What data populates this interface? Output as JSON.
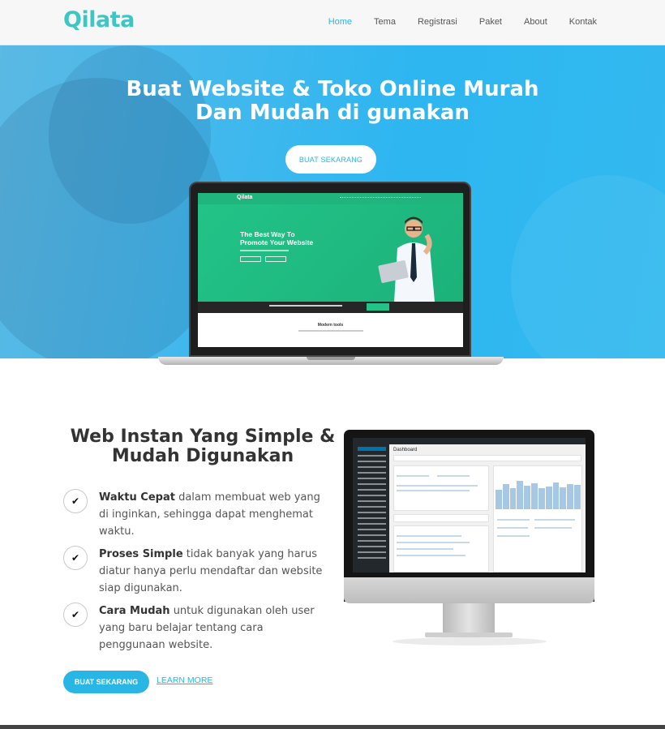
{
  "brand": {
    "logo": "Qilata",
    "accent": "#3ec6c3",
    "primary": "#29b6e4"
  },
  "nav": {
    "items": [
      {
        "label": "Home",
        "active": true
      },
      {
        "label": "Tema"
      },
      {
        "label": "Registrasi"
      },
      {
        "label": "Paket"
      },
      {
        "label": "About"
      },
      {
        "label": "Kontak"
      }
    ]
  },
  "hero": {
    "title_line1": "Buat Website & Toko Online Murah",
    "title_line2": "Dan Mudah di gunakan",
    "cta_label": "BUAT SEKARANG",
    "laptop_screen": {
      "logo": "Qilata",
      "headline_line1": "The Best Way To",
      "headline_line2": "Promote Your Website",
      "section_title": "Modern tools"
    }
  },
  "features": {
    "title_line1": "Web Instan Yang Simple &",
    "title_line2": "Mudah Digunakan",
    "items": [
      {
        "title": "Waktu Cepat",
        "text": "dalam membuat web yang di inginkan, sehingga dapat menghemat waktu.",
        "icon": "check-icon"
      },
      {
        "title": "Proses Simple",
        "text": "tidak banyak yang harus diatur hanya perlu mendaftar dan website siap digunakan.",
        "icon": "check-icon"
      },
      {
        "title": "Cara Mudah",
        "text": "untuk digunakan oleh user yang baru belajar tentang cara penggunaan website.",
        "icon": "check-icon"
      }
    ],
    "cta_primary": "BUAT SEKARANG",
    "cta_link": "LEARN MORE",
    "monitor_screen": {
      "heading": "Dashboard"
    }
  }
}
